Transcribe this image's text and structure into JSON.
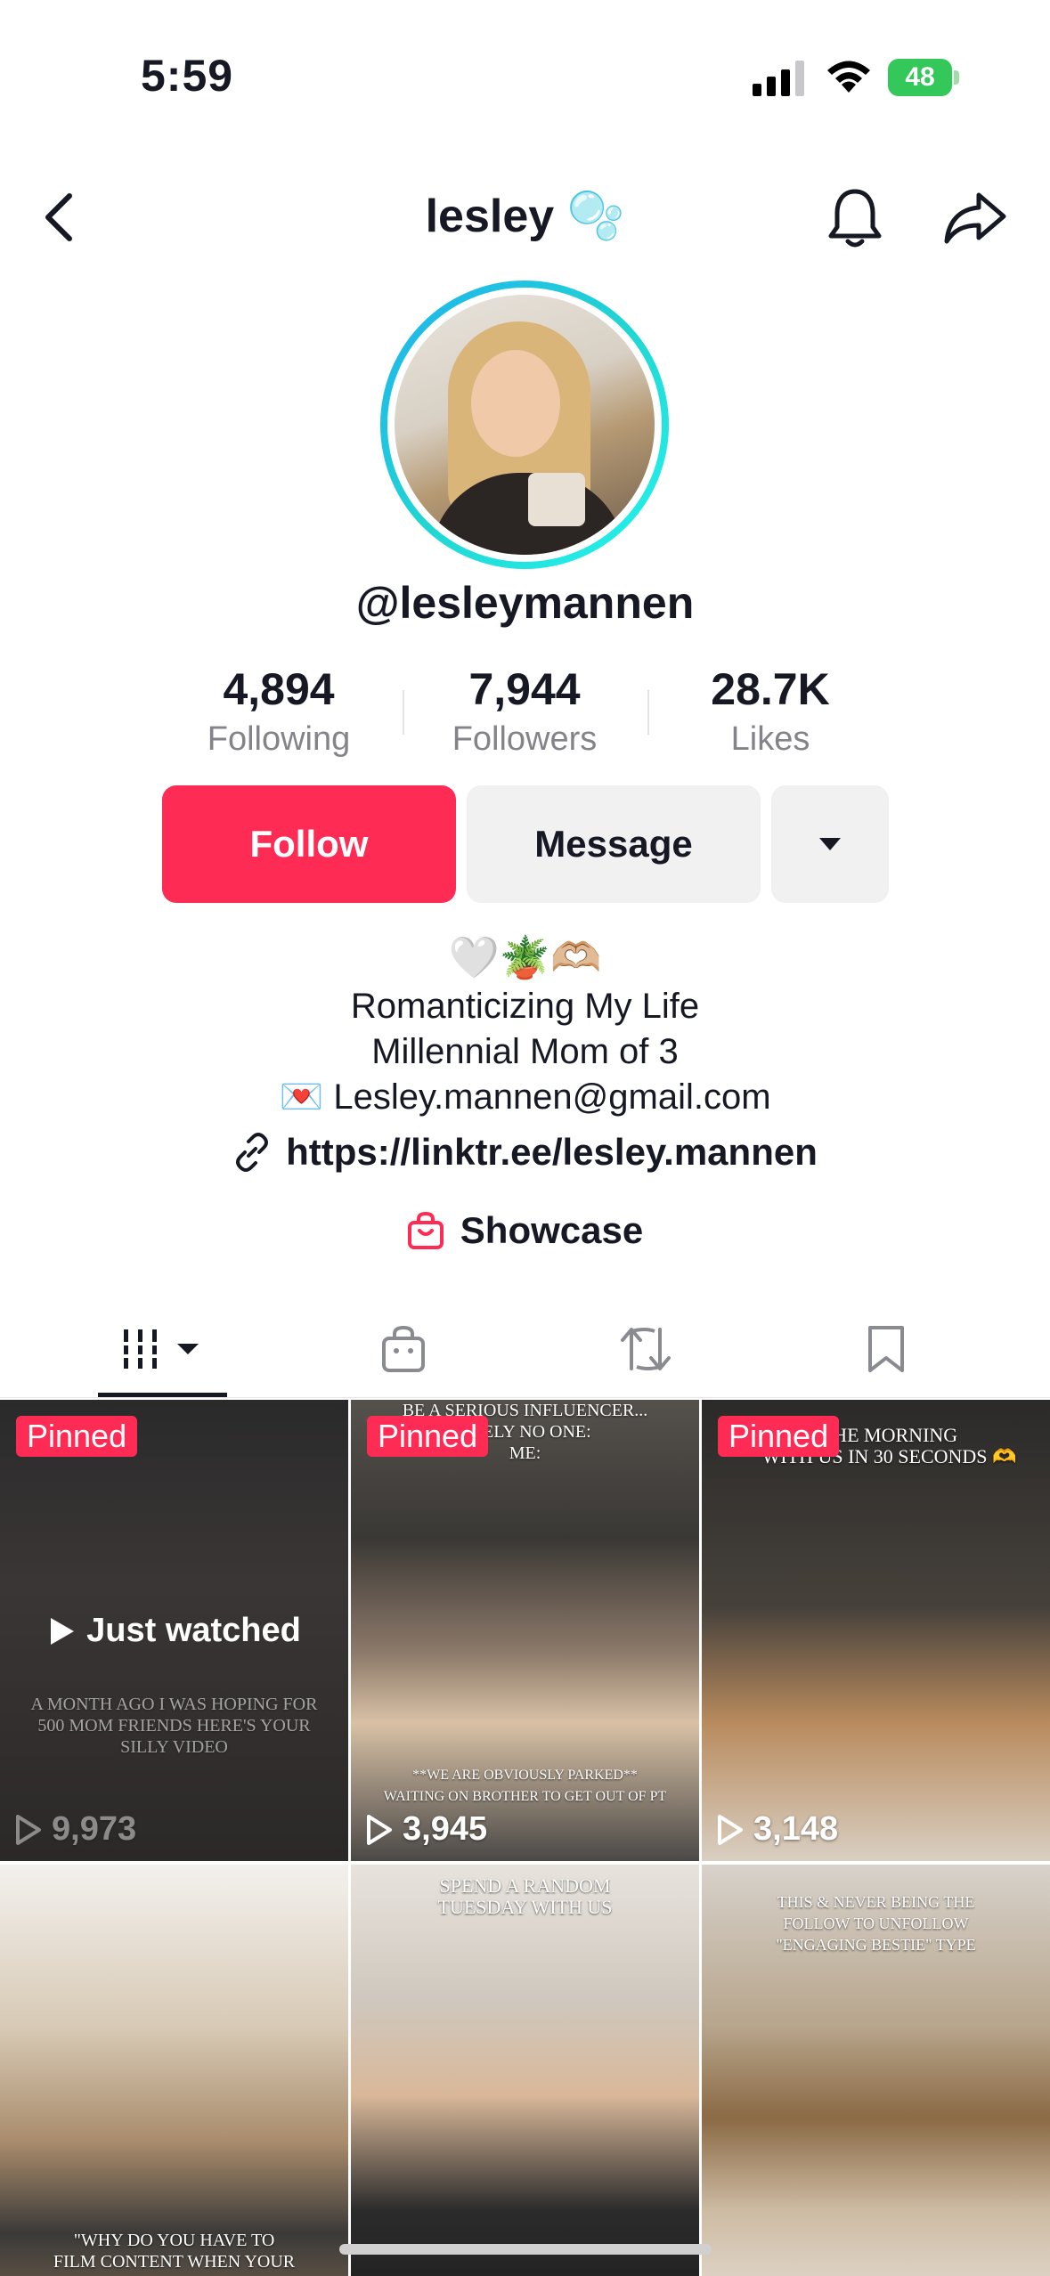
{
  "status_bar": {
    "time": "5:59",
    "battery": "48"
  },
  "header": {
    "title": "lesley 🫧"
  },
  "profile": {
    "handle": "@lesleymannen",
    "stats": [
      {
        "value": "4,894",
        "label": "Following"
      },
      {
        "value": "7,944",
        "label": "Followers"
      },
      {
        "value": "28.7K",
        "label": "Likes"
      }
    ],
    "follow_label": "Follow",
    "message_label": "Message",
    "bio": {
      "emojis": "🤍🪴🫶🏼",
      "line1": "Romanticizing My Life",
      "line2": "Millennial Mom of 3",
      "line3": "💌 Lesley.mannen@gmail.com"
    },
    "link": "https://linktr.ee/lesley.mannen",
    "showcase": "Showcase"
  },
  "accent_color": "#fe2c55",
  "videos": [
    {
      "pinned": "Pinned",
      "views": "9,973",
      "badge": "Just watched",
      "overlay": "A MONTH AGO I WAS HOPING FOR 500 MOM FRIENDS\nHERE'S YOUR SILLY VIDEO"
    },
    {
      "pinned": "Pinned",
      "views": "3,945",
      "overlay_top": "BE A SERIOUS INFLUENCER...\nUTELY NO ONE:\nME:",
      "overlay_bottom": "**WE ARE OBVIOUSLY PARKED**\nWAITING ON BROTHER TO GET OUT OF PT"
    },
    {
      "pinned": "Pinned",
      "views": "3,148",
      "overlay_top": "THE MORNING\nWITH US IN 30 SECONDS 🫶"
    },
    {
      "overlay_bottom": "\"WHY DO YOU HAVE TO\nFILM CONTENT WHEN YOUR"
    },
    {
      "overlay_top": "SPEND A RANDOM\nTUESDAY WITH US"
    },
    {
      "overlay_top": "THIS & NEVER BEING THE\nFOLLOW TO UNFOLLOW\n\"ENGAGING BESTIE\" TYPE"
    }
  ]
}
